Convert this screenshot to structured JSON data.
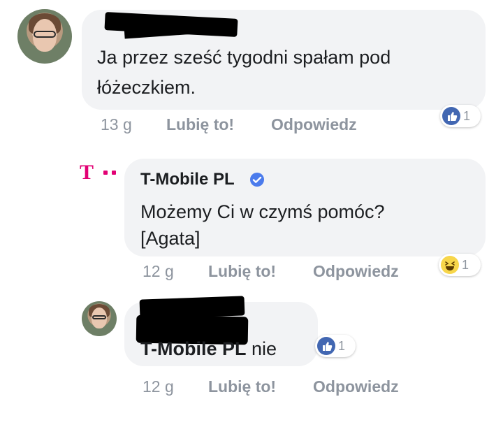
{
  "comments": [
    {
      "text": "Ja przez sześć tygodni spałam pod łóżeczkiem.",
      "text_line1": "Ja przez sześć tygodni spałam pod",
      "text_line2": "łóżeczkiem.",
      "time": "13 g",
      "like_label": "Lubię to!",
      "reply_label": "Odpowiedz",
      "reaction_count": "1",
      "reaction_icon": "like-icon"
    },
    {
      "author": "T-Mobile PL",
      "verified_icon": "verified-badge-icon",
      "text_line1": "Możemy Ci w czymś pomóc?",
      "text_line2": "[Agata]",
      "time": "12 g",
      "like_label": "Lubię to!",
      "reply_label": "Odpowiedz",
      "reaction_count": "1",
      "reaction_icon": "haha-icon",
      "logo_text": "T"
    },
    {
      "tag": "T-Mobile PL",
      "text_after_tag": " nie",
      "time": "12 g",
      "like_label": "Lubię to!",
      "reply_label": "Odpowiedz",
      "reaction_count": "1",
      "reaction_icon": "like-icon"
    }
  ],
  "colors": {
    "bubble": "#f2f3f5",
    "meta": "#8d949e",
    "brand_magenta": "#e20074",
    "facebook_blue": "#4267b2",
    "verified_blue": "#4b7bec"
  }
}
